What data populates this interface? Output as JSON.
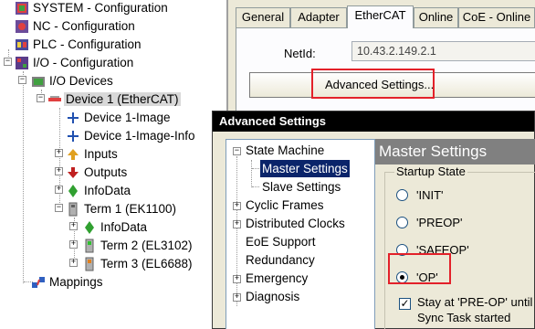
{
  "tree": {
    "items": [
      {
        "label": "SYSTEM - Configuration"
      },
      {
        "label": "NC - Configuration"
      },
      {
        "label": "PLC - Configuration"
      },
      {
        "label": "I/O - Configuration"
      },
      {
        "label": "I/O Devices"
      },
      {
        "label": "Device 1 (EtherCAT)"
      },
      {
        "label": "Device 1-Image"
      },
      {
        "label": "Device 1-Image-Info"
      },
      {
        "label": "Inputs"
      },
      {
        "label": "Outputs"
      },
      {
        "label": "InfoData"
      },
      {
        "label": "Term 1 (EK1100)"
      },
      {
        "label": "InfoData"
      },
      {
        "label": "Term 2 (EL3102)"
      },
      {
        "label": "Term 3 (EL6688)"
      },
      {
        "label": "Mappings"
      }
    ]
  },
  "tabs": [
    "General",
    "Adapter",
    "EtherCAT",
    "Online",
    "CoE - Online"
  ],
  "active_tab": "EtherCAT",
  "ethercat": {
    "netid_label": "NetId:",
    "netid_value": "10.43.2.149.2.1",
    "advanced_button": "Advanced Settings..."
  },
  "dialog": {
    "title": "Advanced Settings",
    "nav": [
      {
        "label": "State Machine"
      },
      {
        "label": "Master Settings"
      },
      {
        "label": "Slave Settings"
      },
      {
        "label": "Cyclic Frames"
      },
      {
        "label": "Distributed Clocks"
      },
      {
        "label": "EoE Support"
      },
      {
        "label": "Redundancy"
      },
      {
        "label": "Emergency"
      },
      {
        "label": "Diagnosis"
      }
    ],
    "section_title": "Master Settings",
    "startup_group": "Startup State",
    "options": [
      "'INIT'",
      "'PREOP'",
      "'SAFEOP'",
      "'OP'"
    ],
    "selected_option": "'OP'",
    "checkbox_line1": "Stay at 'PRE-OP' until",
    "checkbox_line2": "Sync Task started"
  },
  "colors": {
    "highlight": "#e3212a",
    "dialog_title_bg": "#000000",
    "selected_nav_bg": "#0a246a",
    "section_header_bg": "#808080"
  }
}
